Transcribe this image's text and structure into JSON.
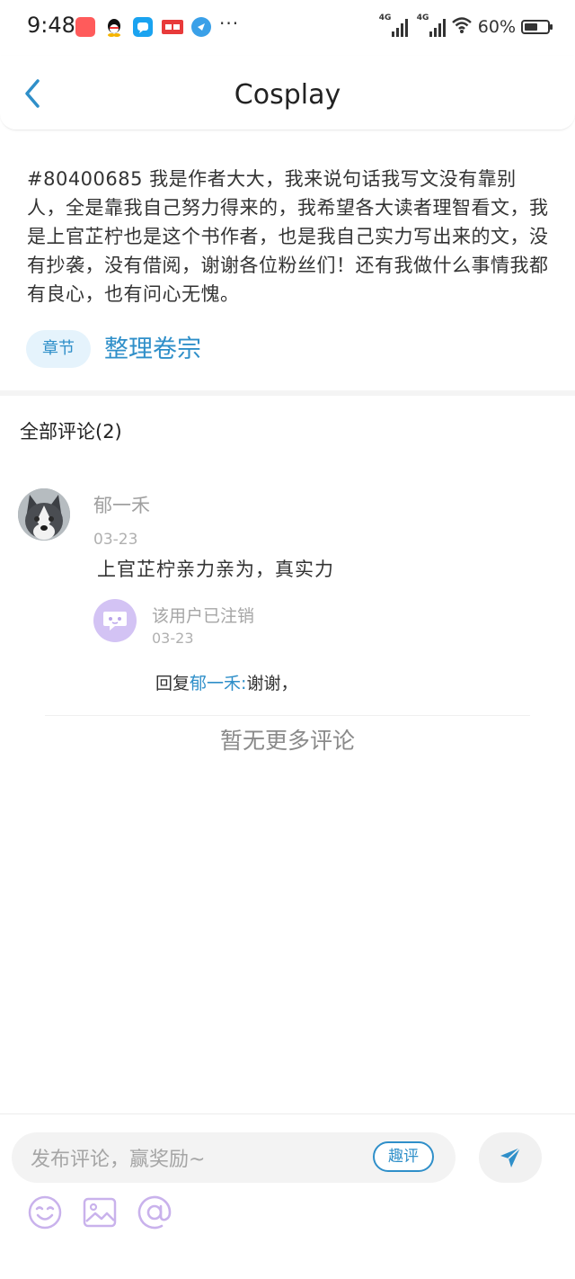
{
  "status_bar": {
    "time": "9:48",
    "network_1": "4G",
    "network_2": "4G",
    "battery": "60%",
    "battery_level": 0.6,
    "more": "···"
  },
  "header": {
    "title": "Cosplay"
  },
  "post": {
    "text": "#80400685 我是作者大大，我来说句话我写文没有靠别人，全是靠我自己努力得来的，我希望各大读者理智看文，我是上官芷柠也是这个书作者，也是我自己实力写出来的文，没有抄袭，没有借阅，谢谢各位粉丝们！还有我做什么事情我都有良心，也有问心无愧。",
    "chip_label": "章节",
    "chapter_title": "整理卷宗"
  },
  "comments": {
    "heading": "全部评论(2)",
    "items": [
      {
        "author": "郁一禾",
        "date": "03-23",
        "text": "上官芷柠亲力亲为，真实力",
        "reply": {
          "author": "该用户已注销",
          "date": "03-23",
          "prefix": "回复",
          "mention": "郁一禾",
          "separator": ":",
          "text": "谢谢，"
        }
      }
    ],
    "end_text": "暂无更多评论"
  },
  "composer": {
    "placeholder": "发布评论，赢奖励~",
    "badge": "趣评"
  },
  "colors": {
    "accent": "#2f8fc9",
    "chip_bg": "#e5f3fc",
    "send_icon": "#2f8fc9",
    "tool_icon": "#c9b2ec"
  }
}
